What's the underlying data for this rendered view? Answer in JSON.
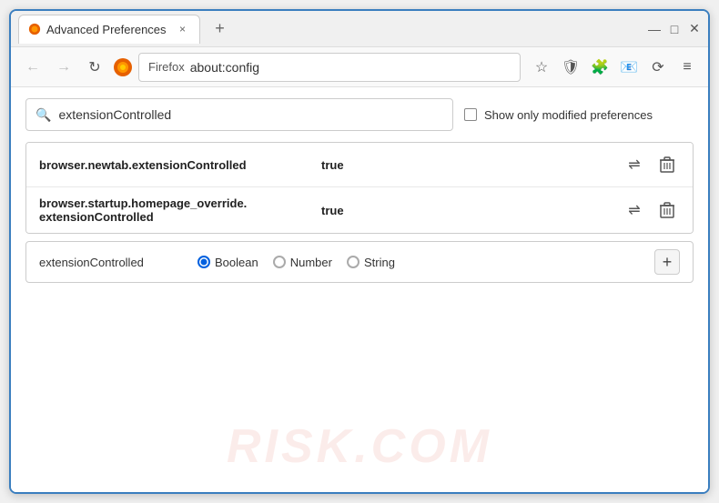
{
  "window": {
    "title": "Advanced Preferences",
    "tab_close": "×",
    "new_tab": "+",
    "minimize": "—",
    "maximize": "□",
    "close": "✕"
  },
  "navbar": {
    "back": "←",
    "forward": "→",
    "reload": "↻",
    "brand": "Firefox",
    "url": "about:config",
    "bookmark": "☆",
    "shield": "🛡",
    "extension": "🧩",
    "sync": "📧",
    "history": "⟳",
    "menu": "≡"
  },
  "search": {
    "placeholder": "extensionControlled",
    "value": "extensionControlled",
    "show_modified_label": "Show only modified preferences"
  },
  "results": [
    {
      "name": "browser.newtab.extensionControlled",
      "value": "true"
    },
    {
      "name_line1": "browser.startup.homepage_override.",
      "name_line2": "extensionControlled",
      "value": "true"
    }
  ],
  "add_preference": {
    "name": "extensionControlled",
    "type_options": [
      "Boolean",
      "Number",
      "String"
    ],
    "selected_type": "Boolean",
    "add_button": "+"
  },
  "icons": {
    "search": "🔍",
    "reset": "⇌",
    "delete": "🗑",
    "arrow_lr": "⇌"
  },
  "watermark": "RISK.COM"
}
